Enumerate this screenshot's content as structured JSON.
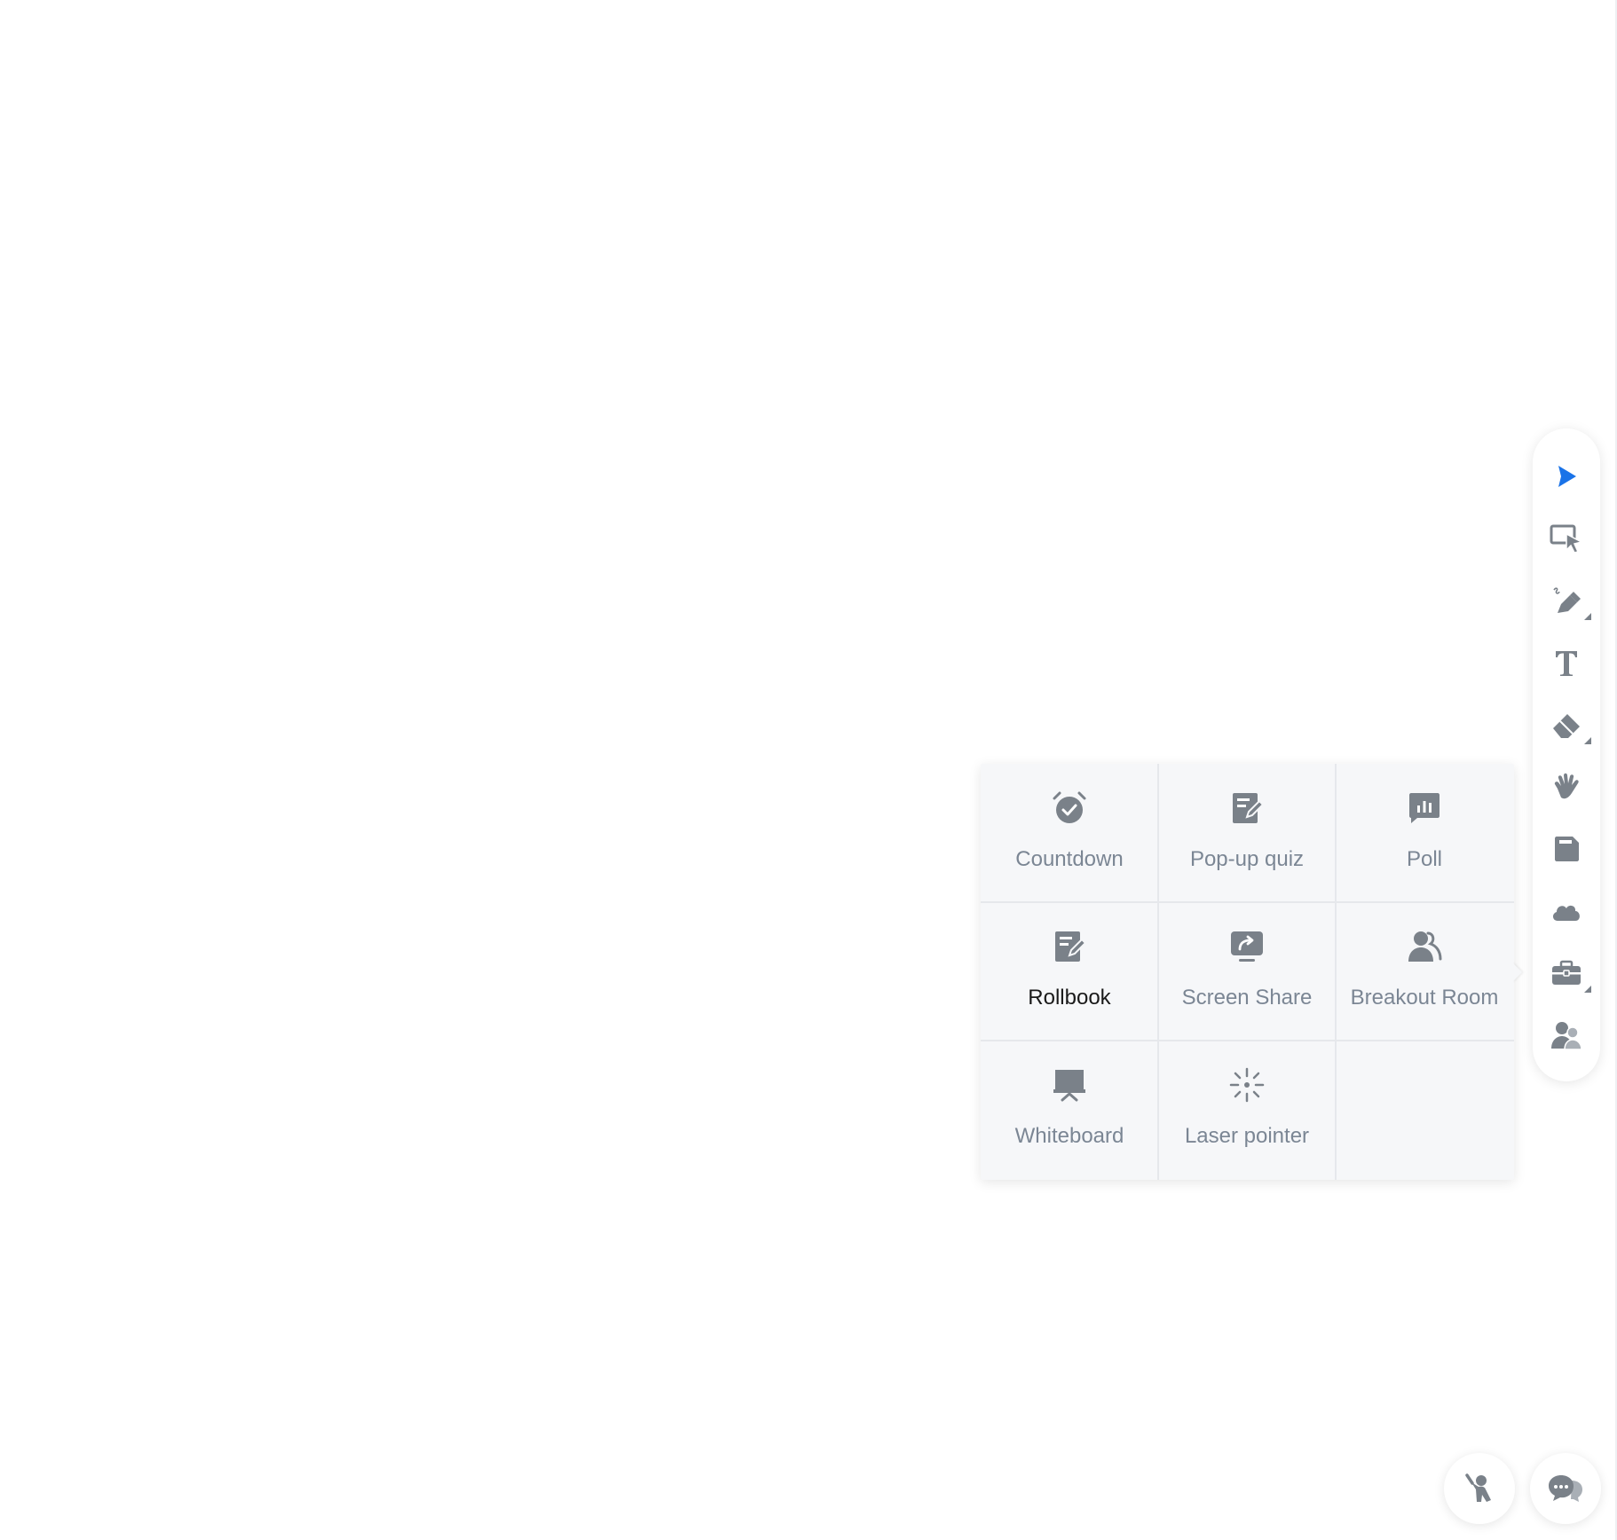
{
  "toolbar": {
    "tools": [
      {
        "name": "select-tool",
        "icon": "cursor-arrow-icon",
        "active": true
      },
      {
        "name": "area-select-tool",
        "icon": "box-select-icon"
      },
      {
        "name": "pen-tool",
        "icon": "pen-icon",
        "has_submenu": true
      },
      {
        "name": "text-tool",
        "icon": "text-t-icon"
      },
      {
        "name": "eraser-tool",
        "icon": "eraser-icon",
        "has_submenu": true
      },
      {
        "name": "hand-tool",
        "icon": "hand-icon"
      },
      {
        "name": "save-tool",
        "icon": "save-icon"
      },
      {
        "name": "cloud-tool",
        "icon": "cloud-icon"
      },
      {
        "name": "toolbox-tool",
        "icon": "toolbox-icon",
        "has_submenu": true
      },
      {
        "name": "users-tool",
        "icon": "users-icon"
      }
    ]
  },
  "toolbox_menu": {
    "items": [
      {
        "label": "Countdown",
        "icon": "alarm-clock-icon"
      },
      {
        "label": "Pop-up quiz",
        "icon": "quiz-edit-icon"
      },
      {
        "label": "Poll",
        "icon": "poll-chart-icon"
      },
      {
        "label": "Rollbook",
        "icon": "rollbook-edit-icon",
        "active": true
      },
      {
        "label": "Screen Share",
        "icon": "screen-share-icon"
      },
      {
        "label": "Breakout Room",
        "icon": "breakout-room-icon"
      },
      {
        "label": "Whiteboard",
        "icon": "whiteboard-easel-icon"
      },
      {
        "label": "Laser pointer",
        "icon": "laser-pointer-icon"
      }
    ]
  },
  "bottom_buttons": [
    {
      "name": "raise-hand-button",
      "icon": "raise-hand-icon"
    },
    {
      "name": "chat-button",
      "icon": "chat-bubbles-icon"
    }
  ],
  "colors": {
    "accent": "#1a73e8",
    "icon": "#7a8189",
    "label": "#7b8694",
    "active_label": "#1a1a1a",
    "panel_bg": "#f6f7f9"
  }
}
